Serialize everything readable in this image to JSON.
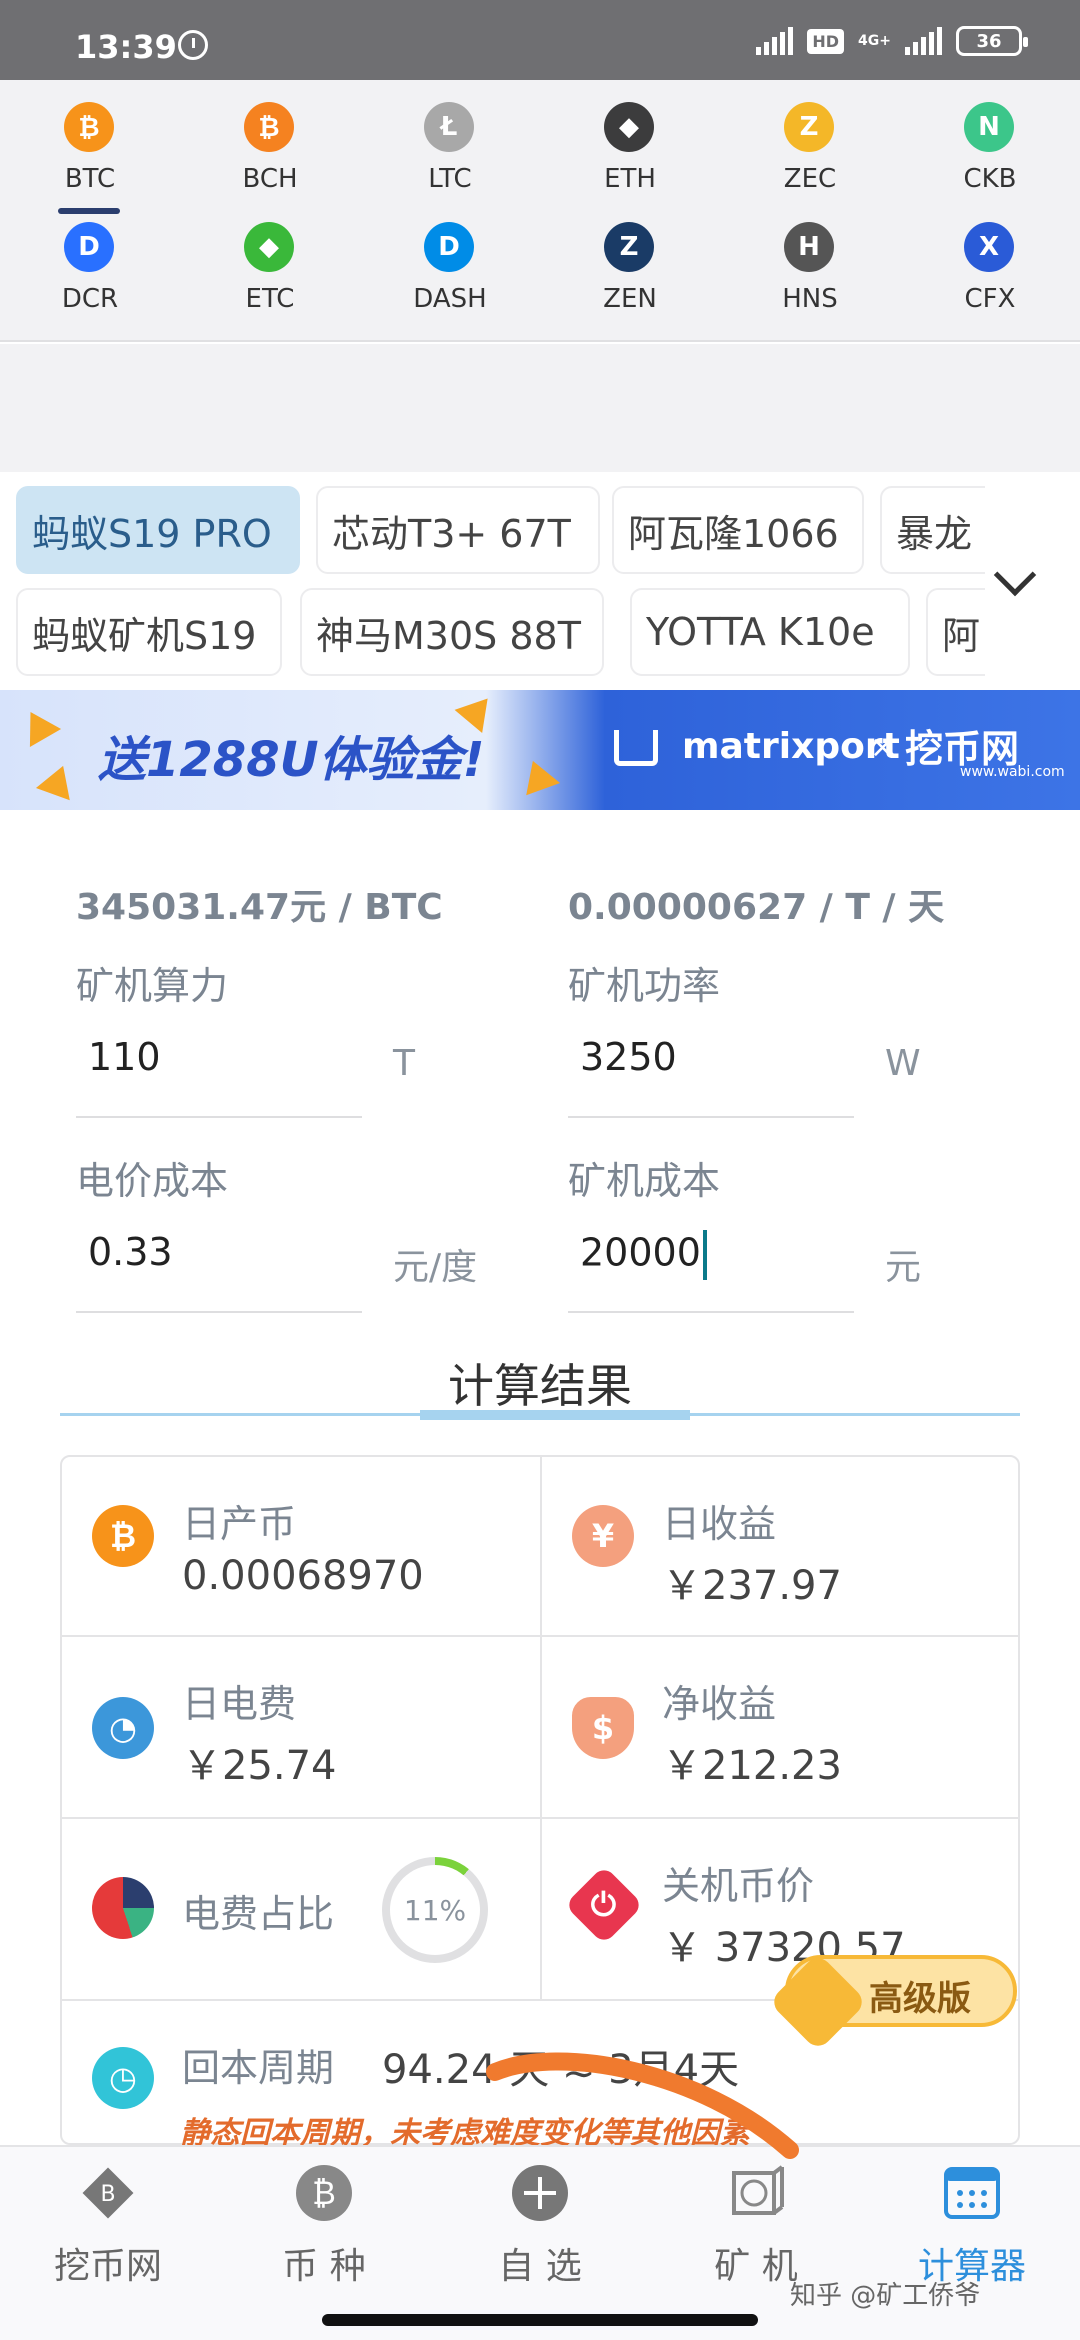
{
  "status_bar": {
    "time": "13:39",
    "network": "4G+",
    "hd": "HD",
    "battery": "36"
  },
  "coins": [
    {
      "label": "BTC",
      "color": "#f7931a",
      "glyph": "₿",
      "icon": "bitcoin-icon"
    },
    {
      "label": "BCH",
      "color": "#f58220",
      "glyph": "₿",
      "icon": "bitcoin-cash-icon"
    },
    {
      "label": "LTC",
      "color": "#a8a8a8",
      "glyph": "Ł",
      "icon": "litecoin-icon"
    },
    {
      "label": "ETH",
      "color": "#3c3c3d",
      "glyph": "◆",
      "icon": "ethereum-icon"
    },
    {
      "label": "ZEC",
      "color": "#f4b728",
      "glyph": "Z",
      "icon": "zcash-icon"
    },
    {
      "label": "CKB",
      "color": "#3cc68a",
      "glyph": "N",
      "icon": "nervos-icon"
    },
    {
      "label": "DCR",
      "color": "#2970ff",
      "glyph": "D",
      "icon": "decred-icon"
    },
    {
      "label": "ETC",
      "color": "#3ab83a",
      "glyph": "◆",
      "icon": "ethereum-classic-icon"
    },
    {
      "label": "DASH",
      "color": "#008ce7",
      "glyph": "D",
      "icon": "dash-icon"
    },
    {
      "label": "ZEN",
      "color": "#1a3b66",
      "glyph": "Z",
      "icon": "horizen-icon"
    },
    {
      "label": "HNS",
      "color": "#555555",
      "glyph": "H",
      "icon": "handshake-icon"
    },
    {
      "label": "CFX",
      "color": "#2a5bd7",
      "glyph": "X",
      "icon": "conflux-icon"
    }
  ],
  "selected_coin": "BTC",
  "miners_row1": [
    "蚂蚁S19 PRO",
    "芯动T3+ 67T",
    "阿瓦隆1066",
    "暴龙"
  ],
  "miners_row2": [
    "蚂蚁矿机S19",
    "神马M30S 88T",
    "YOTTA K10e",
    "阿"
  ],
  "banner": {
    "promo": "送1288U体验金!",
    "brand1": "matrixport",
    "separator": "×",
    "brand2": "挖币网",
    "brand2_url": "www.wabi.com"
  },
  "calculator": {
    "coin_price": "345031.47元 / BTC",
    "unit_output": "0.00000627 / T / 天",
    "hashrate_label": "矿机算力",
    "hashrate_value": "110",
    "hashrate_unit": "T",
    "power_label": "矿机功率",
    "power_value": "3250",
    "power_unit": "W",
    "elec_label": "电价成本",
    "elec_value": "0.33",
    "elec_unit": "元/度",
    "cost_label": "矿机成本",
    "cost_value": "20000",
    "cost_unit": "元"
  },
  "results": {
    "title": "计算结果",
    "daily_coin_label": "日产币",
    "daily_coin_value": "0.00068970",
    "daily_income_label": "日收益",
    "daily_income_value": "￥237.97",
    "daily_elec_label": "日电费",
    "daily_elec_value": "￥25.74",
    "net_income_label": "净收益",
    "net_income_value": "￥212.23",
    "elec_ratio_label": "电费占比",
    "elec_ratio_value": "11%",
    "elec_ratio_fraction": 0.11,
    "shutdown_label": "关机币价",
    "shutdown_value": "￥ 37320.57",
    "payback_label": "回本周期",
    "payback_value": "94.24 天 ≈ 3月4天",
    "payback_note": "静态回本周期，未考虑难度变化等其他因素",
    "pro_label": "高级版"
  },
  "nav": [
    {
      "label": "挖币网",
      "icon": "wabi-logo-icon"
    },
    {
      "label": "币 种",
      "icon": "coin-icon"
    },
    {
      "label": "自 选",
      "icon": "add-icon"
    },
    {
      "label": "矿 机",
      "icon": "miner-icon"
    },
    {
      "label": "计算器",
      "icon": "calculator-icon"
    }
  ],
  "active_nav": "计算器",
  "watermark": "知乎 @矿工侨爷",
  "colors": {
    "accent": "#2d8fdc",
    "chip_active_bg": "#cde4f3",
    "result_line": "#a6d3ef",
    "pro_gold": "#f7b937",
    "note_orange": "#e36b2c"
  }
}
